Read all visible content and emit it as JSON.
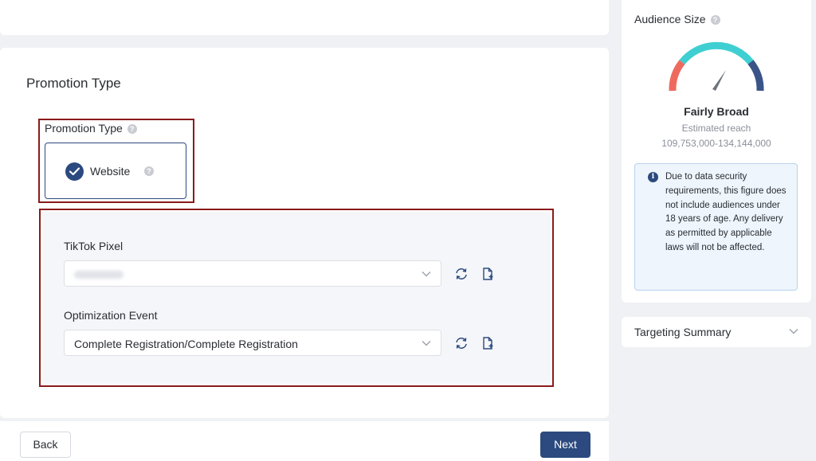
{
  "main": {
    "section_title": "Promotion Type",
    "promotion_type": {
      "label": "Promotion Type",
      "selected_option": "Website"
    },
    "pixel": {
      "label": "TikTok Pixel",
      "value": ""
    },
    "optimization_event": {
      "label": "Optimization Event",
      "value": "Complete Registration/Complete Registration"
    }
  },
  "footer": {
    "back_label": "Back",
    "next_label": "Next"
  },
  "sidebar": {
    "audience_title": "Audience Size",
    "gauge_status": "Fairly Broad",
    "estimated_label": "Estimated reach",
    "reach_range": "109,753,000-134,144,000",
    "notice": "Due to data security requirements, this figure does not include audiences under 18 years of age. Any delivery as permitted by applicable laws will not be affected.",
    "summary_title": "Targeting Summary"
  },
  "icons": {
    "help": "question-mark-circle",
    "check": "check-circle",
    "refresh": "refresh",
    "add_file": "file-add",
    "info": "info-circle",
    "chevron": "chevron-down"
  },
  "colors": {
    "primary": "#2c4a7f",
    "annotation_red": "#8b1a1a",
    "gauge_red": "#ef6a5e",
    "gauge_teal": "#3fcfd2",
    "gauge_navy": "#3a5488"
  }
}
